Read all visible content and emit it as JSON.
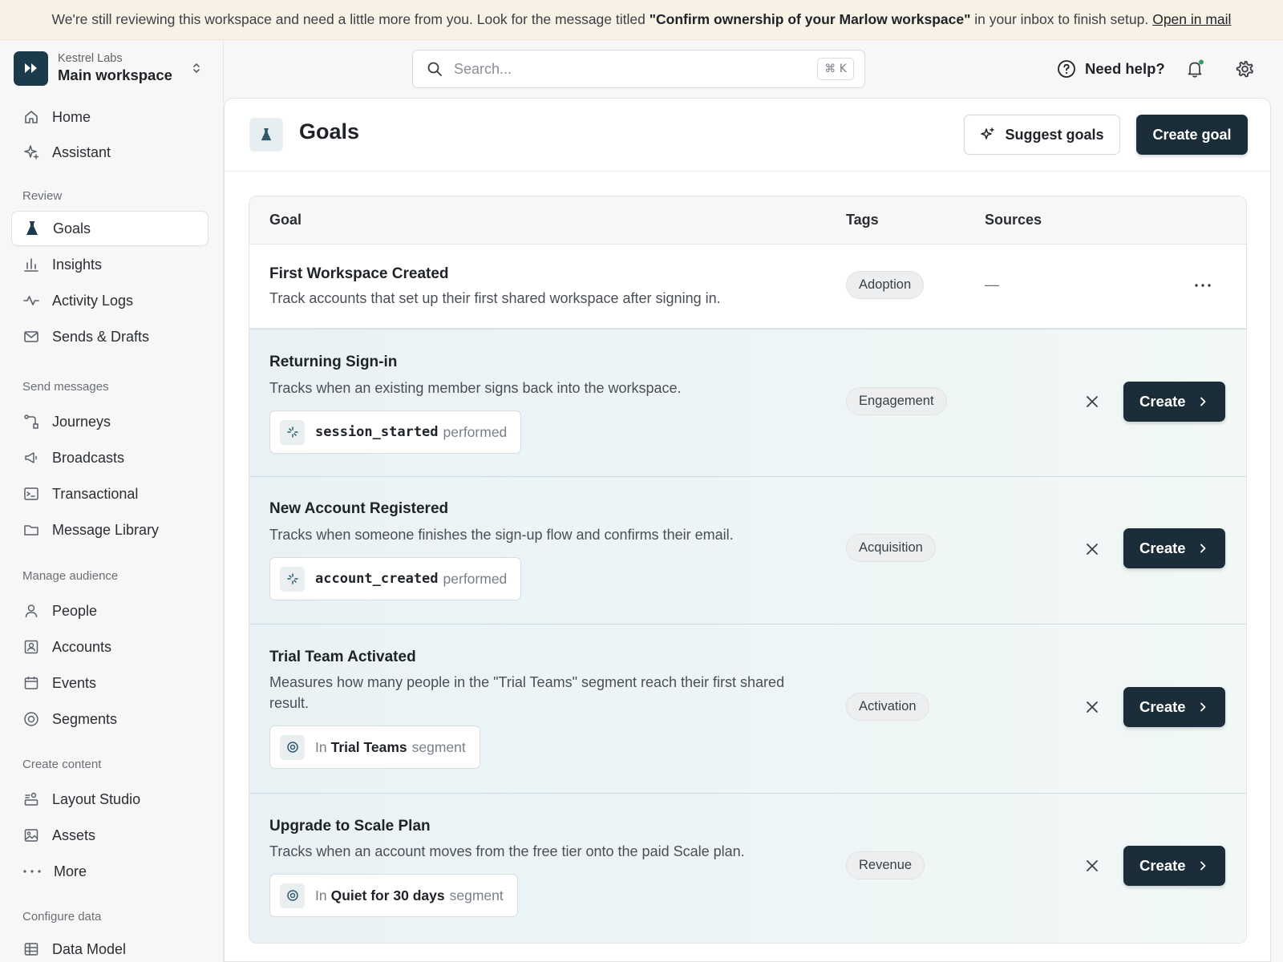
{
  "banner": {
    "text_before": "We're still reviewing this workspace and need a little more from you. Look for the message titled ",
    "highlight": "\"Confirm ownership of your Marlow workspace\"",
    "text_after": " in your inbox to finish setup.",
    "link": "Open in mail"
  },
  "workspace": {
    "org": "Kestrel Labs",
    "name": "Main workspace"
  },
  "sidebar": {
    "top_items": [
      {
        "label": "Home",
        "icon": "home-icon"
      },
      {
        "label": "Assistant",
        "icon": "sparkle-icon"
      }
    ],
    "review": {
      "title": "Review",
      "items": [
        {
          "label": "Goals",
          "icon": "flask-icon",
          "active": true
        },
        {
          "label": "Insights",
          "icon": "bar-chart-icon"
        },
        {
          "label": "Activity Logs",
          "icon": "activity-icon"
        },
        {
          "label": "Sends & Drafts",
          "icon": "mail-icon"
        }
      ]
    },
    "send": {
      "title": "Send messages",
      "items": [
        {
          "label": "Journeys",
          "icon": "journey-icon"
        },
        {
          "label": "Broadcasts",
          "icon": "megaphone-icon"
        },
        {
          "label": "Transactional",
          "icon": "terminal-icon"
        },
        {
          "label": "Message Library",
          "icon": "folder-icon"
        }
      ]
    },
    "audience": {
      "title": "Manage audience",
      "items": [
        {
          "label": "People",
          "icon": "person-icon"
        },
        {
          "label": "Accounts",
          "icon": "account-icon"
        },
        {
          "label": "Events",
          "icon": "calendar-icon"
        },
        {
          "label": "Segments",
          "icon": "target-icon"
        }
      ]
    },
    "content": {
      "title": "Create content",
      "items": [
        {
          "label": "Layout Studio",
          "icon": "layout-icon"
        },
        {
          "label": "Assets",
          "icon": "image-icon"
        },
        {
          "label": "More",
          "icon": "more-dots-icon"
        }
      ]
    },
    "data": {
      "title": "Configure data",
      "items": [
        {
          "label": "Data Model",
          "icon": "table-icon"
        }
      ]
    }
  },
  "header": {
    "search_placeholder": "Search...",
    "search_shortcut": "⌘ K",
    "help": "Need help?"
  },
  "page": {
    "title": "Goals",
    "suggest_button": "Suggest goals",
    "create_button": "Create goal"
  },
  "table": {
    "columns": [
      "Goal",
      "Tags",
      "Sources"
    ],
    "rows": [
      {
        "title": "First Workspace Created",
        "description": "Track accounts that set up their first shared workspace after signing in.",
        "tag": "Adoption",
        "source": "—"
      },
      {
        "title": "Returning Sign-in",
        "description": "Tracks when an existing member signs back into the workspace.",
        "condition": {
          "code": "session_started",
          "suffix": "performed"
        },
        "tag": "Engagement",
        "action": "Create"
      },
      {
        "title": "New Account Registered",
        "description": "Tracks when someone finishes the sign-up flow and confirms their email.",
        "condition": {
          "code": "account_created",
          "suffix": "performed"
        },
        "tag": "Acquisition",
        "action": "Create"
      },
      {
        "title": "Trial Team Activated",
        "description": "Measures how many people in the \"Trial Teams\" segment reach their first shared result.",
        "condition": {
          "prefix": "In",
          "segment": "Trial Teams",
          "suffix": "segment"
        },
        "tag": "Activation",
        "action": "Create"
      },
      {
        "title": "Upgrade to Scale Plan",
        "description": "Tracks when an account moves from the free tier onto the paid Scale plan.",
        "condition": {
          "prefix": "In",
          "segment": "Quiet for 30 days",
          "suffix": "segment"
        },
        "tag": "Revenue",
        "action": "Create"
      }
    ]
  },
  "colors": {
    "primary": "#1b2d38",
    "banner_bg": "#f8f1e6",
    "suggested_row_bg": "#e8f2f5",
    "notification_dot": "#2e9e6b"
  }
}
